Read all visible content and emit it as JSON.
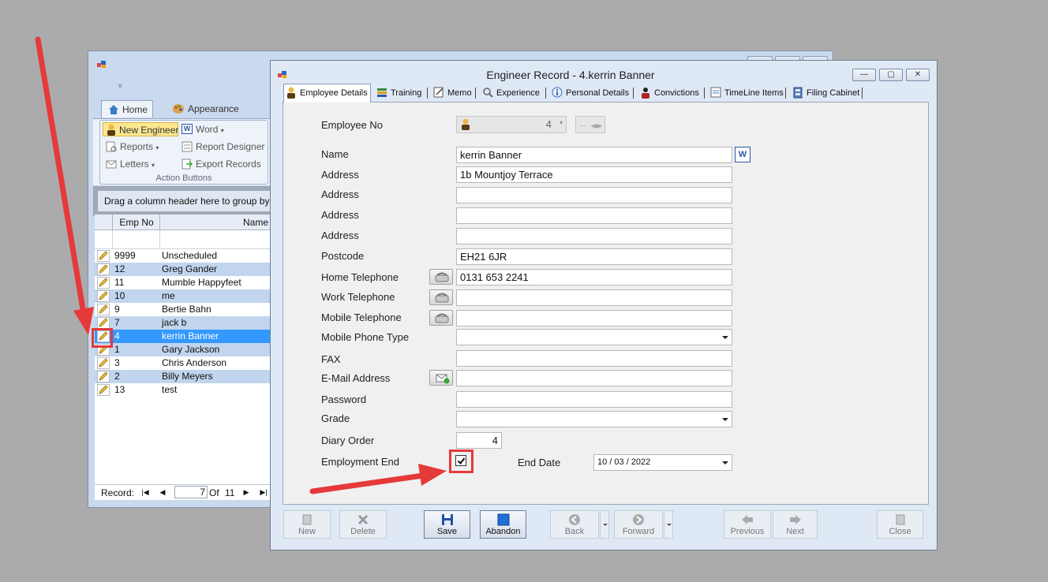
{
  "colors": {
    "desktop": "#ababab",
    "selection": "#3399ff",
    "annotation": "#e5393a",
    "alt_row": "#c1d5ee"
  },
  "bg_window": {
    "ribbon_tabs": [
      {
        "label": "Home",
        "icon": "home-icon"
      },
      {
        "label": "Appearance",
        "icon": "palette-icon"
      }
    ],
    "actions": {
      "new_engineer": "New Engineer",
      "word": "Word",
      "reports": "Reports",
      "report_designer": "Report Designer",
      "letters": "Letters",
      "export_records": "Export Records",
      "group_label": "Action Buttons"
    },
    "group_hint": "Drag a column header here to group by tha",
    "columns": {
      "emp_no": "Emp No",
      "name": "Name"
    },
    "rows": [
      {
        "emp": "9999",
        "name": "Unscheduled"
      },
      {
        "emp": "12",
        "name": "Greg Gander"
      },
      {
        "emp": "11",
        "name": "Mumble Happyfeet"
      },
      {
        "emp": "10",
        "name": "me"
      },
      {
        "emp": "9",
        "name": "Bertie Bahn"
      },
      {
        "emp": "7",
        "name": "jack b"
      },
      {
        "emp": "4",
        "name": "kerrin Banner"
      },
      {
        "emp": "1",
        "name": "Gary Jackson"
      },
      {
        "emp": "3",
        "name": "Chris Anderson"
      },
      {
        "emp": "2",
        "name": "Billy Meyers"
      },
      {
        "emp": "13",
        "name": "test"
      }
    ],
    "nav": {
      "record_label": "Record:",
      "current": "7",
      "of": "Of",
      "total": "11"
    }
  },
  "dialog": {
    "title": "Engineer Record - 4.kerrin Banner",
    "tabs": [
      {
        "label": "Employee Details",
        "icon": "person-icon"
      },
      {
        "label": "Training",
        "icon": "books-icon"
      },
      {
        "label": "Memo",
        "icon": "memo-icon"
      },
      {
        "label": "Experience",
        "icon": "experience-icon"
      },
      {
        "label": "Personal Details",
        "icon": "info-icon"
      },
      {
        "label": "Convictions",
        "icon": "convictions-icon"
      },
      {
        "label": "TimeLine Items",
        "icon": "timeline-icon"
      },
      {
        "label": "Filing Cabinet",
        "icon": "cabinet-icon"
      }
    ],
    "form": {
      "employee_no_label": "Employee No",
      "employee_no": "4",
      "link_btn": "...",
      "name_label": "Name",
      "name": "kerrin Banner",
      "address_label": "Address",
      "address1": "1b Mountjoy Terrace",
      "address2": "",
      "address3": "",
      "address4": "",
      "postcode_label": "Postcode",
      "postcode": "EH21 6JR",
      "home_tel_label": "Home Telephone",
      "home_tel": "0131 653 2241",
      "work_tel_label": "Work Telephone",
      "work_tel": "",
      "mobile_tel_label": "Mobile Telephone",
      "mobile_tel": "",
      "mobile_type_label": "Mobile Phone Type",
      "mobile_type": "",
      "fax_label": "FAX",
      "fax": "",
      "email_label": "E-Mail Address",
      "email": "",
      "password_label": "Password",
      "password": "",
      "grade_label": "Grade",
      "grade": "",
      "diary_label": "Diary Order",
      "diary": "4",
      "employment_end_label": "Employment End",
      "employment_end_checked": true,
      "end_date_label": "End Date",
      "end_date": "10 / 03 / 2022"
    },
    "toolbar": {
      "new": "New",
      "delete": "Delete",
      "save": "Save",
      "abandon": "Abandon",
      "back": "Back",
      "forward": "Forward",
      "previous": "Previous",
      "next": "Next",
      "close": "Close"
    }
  }
}
